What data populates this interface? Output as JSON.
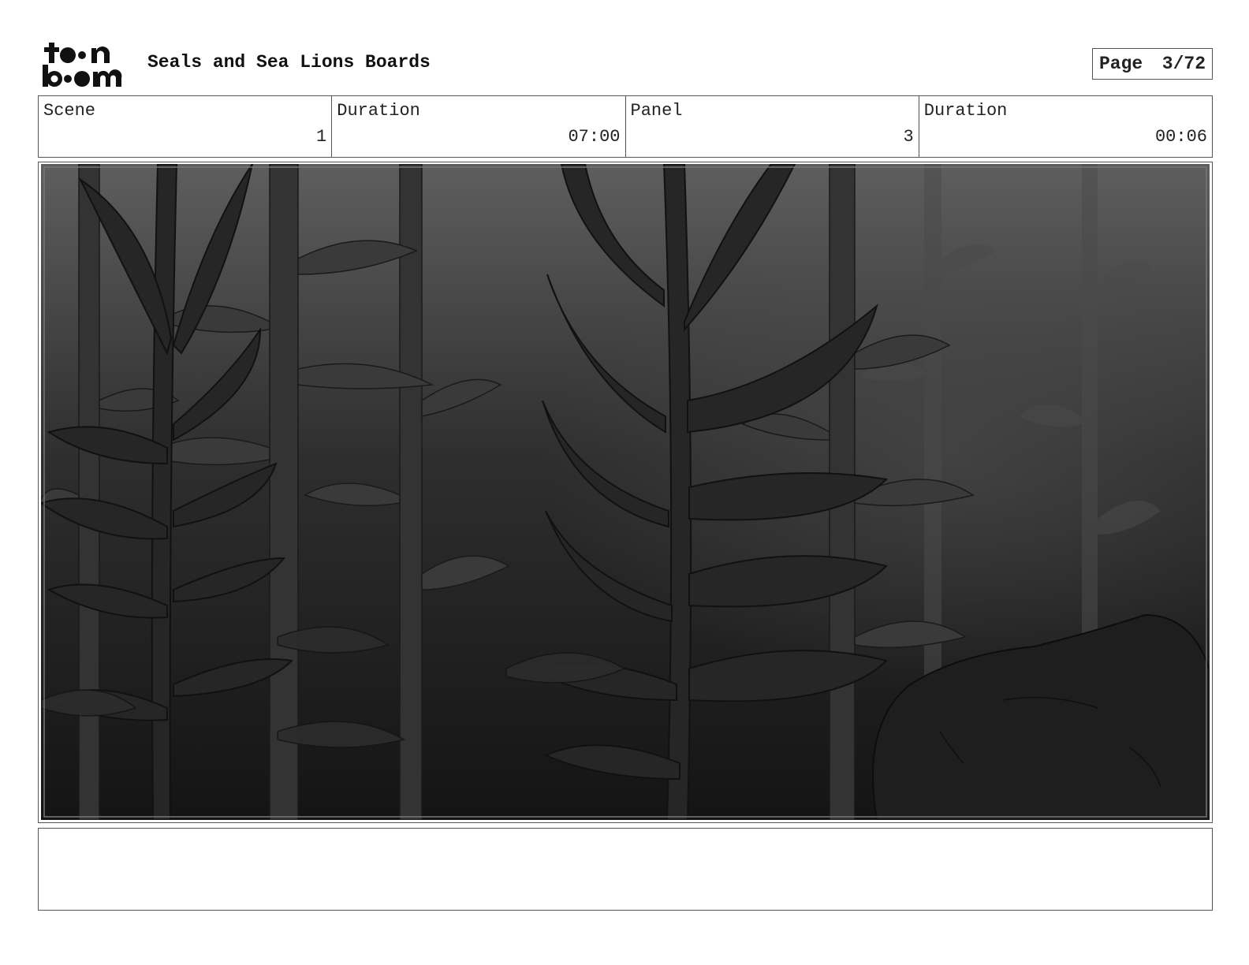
{
  "header": {
    "logo_text": [
      "toon",
      "boom"
    ],
    "title": "Seals and Sea Lions Boards",
    "page_label": "Page",
    "page_value": "3/72"
  },
  "info": {
    "scene_label": "Scene",
    "scene_value": "1",
    "scene_duration_label": "Duration",
    "scene_duration_value": "07:00",
    "panel_label": "Panel",
    "panel_value": "3",
    "panel_duration_label": "Duration",
    "panel_duration_value": "00:06"
  },
  "panel": {
    "image_description": "kelp-forest-background"
  },
  "notes": {
    "text": ""
  }
}
